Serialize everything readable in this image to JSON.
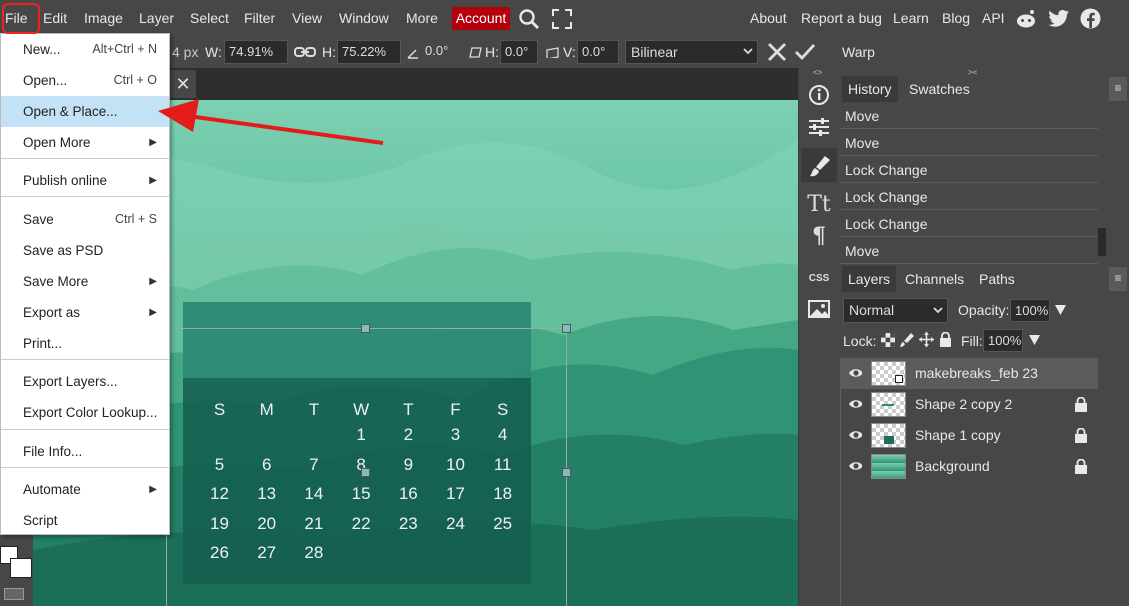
{
  "menubar": {
    "items": [
      "File",
      "Edit",
      "Image",
      "Layer",
      "Select",
      "Filter",
      "View",
      "Window",
      "More"
    ],
    "account": "Account",
    "right_links": [
      "About",
      "Report a bug",
      "Learn",
      "Blog",
      "API"
    ]
  },
  "toolbar": {
    "x_value_partial": "4 px",
    "w_label": "W:",
    "w_value": "74.91%",
    "h_label": "H:",
    "h_value": "75.22%",
    "angle_value": "0.0°",
    "skew_h_label": "H:",
    "skew_h_value": "0.0°",
    "skew_v_label": "V:",
    "skew_v_value": "0.0°",
    "interpolation": "Bilinear",
    "warp_label": "Warp"
  },
  "file_menu": {
    "items": [
      {
        "label": "New...",
        "shortcut": "Alt+Ctrl + N"
      },
      {
        "label": "Open...",
        "shortcut": "Ctrl + O"
      },
      {
        "label": "Open & Place...",
        "shortcut": ""
      },
      {
        "label": "Open More",
        "shortcut": ""
      },
      {
        "label": "Publish online",
        "shortcut": ""
      },
      {
        "label": "Save",
        "shortcut": "Ctrl + S"
      },
      {
        "label": "Save as PSD",
        "shortcut": ""
      },
      {
        "label": "Save More",
        "shortcut": ""
      },
      {
        "label": "Export as",
        "shortcut": ""
      },
      {
        "label": "Print...",
        "shortcut": ""
      },
      {
        "label": "Export Layers...",
        "shortcut": ""
      },
      {
        "label": "Export Color Lookup...",
        "shortcut": ""
      },
      {
        "label": "File Info...",
        "shortcut": ""
      },
      {
        "label": "Automate",
        "shortcut": ""
      },
      {
        "label": "Script",
        "shortcut": ""
      }
    ]
  },
  "history_panel": {
    "tabs": [
      "History",
      "Swatches"
    ],
    "entries": [
      "Move",
      "Move",
      "Lock Change",
      "Lock Change",
      "Lock Change",
      "Move"
    ]
  },
  "layers_panel": {
    "tabs": [
      "Layers",
      "Channels",
      "Paths"
    ],
    "blend_mode": "Normal",
    "opacity_label": "Opacity:",
    "opacity_value": "100%",
    "lock_label": "Lock:",
    "fill_label": "Fill:",
    "fill_value": "100%",
    "layers": [
      {
        "name": "makebreaks_feb 23",
        "locked": false,
        "selected": true
      },
      {
        "name": "Shape 2 copy 2",
        "locked": true,
        "selected": false
      },
      {
        "name": "Shape 1 copy",
        "locked": true,
        "selected": false
      },
      {
        "name": "Background",
        "locked": true,
        "selected": false
      }
    ]
  },
  "tool_column": {
    "css_label": "CSS"
  },
  "calendar": {
    "weekdays": [
      "S",
      "M",
      "T",
      "W",
      "T",
      "F",
      "S"
    ],
    "weeks": [
      [
        "",
        "",
        "",
        "1",
        "2",
        "3",
        "4"
      ],
      [
        "5",
        "6",
        "7",
        "8",
        "9",
        "10",
        "11"
      ],
      [
        "12",
        "13",
        "14",
        "15",
        "16",
        "17",
        "18"
      ],
      [
        "19",
        "20",
        "21",
        "22",
        "23",
        "24",
        "25"
      ],
      [
        "26",
        "27",
        "28",
        "",
        "",
        "",
        ""
      ]
    ]
  },
  "colors": {
    "accent_red": "#b3000c",
    "menu_hover": "#c4e2f5",
    "annotation_red": "#e31b1b"
  }
}
